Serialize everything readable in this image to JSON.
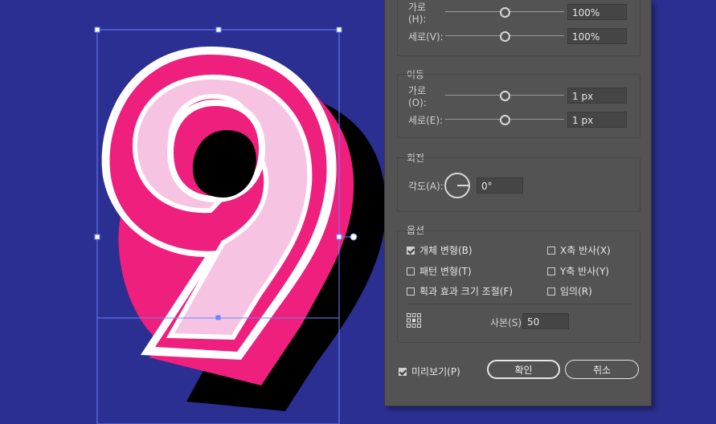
{
  "scale": {
    "horizontal_label": "가로(H):",
    "horizontal_value": "100%",
    "horizontal_level": 0.5,
    "vertical_label": "세로(V):",
    "vertical_value": "100%",
    "vertical_level": 0.5
  },
  "move": {
    "title": "이동",
    "horizontal_label": "가로(O):",
    "horizontal_value": "1 px",
    "horizontal_level": 0.5,
    "vertical_label": "세로(E):",
    "vertical_value": "1 px",
    "vertical_level": 0.5
  },
  "rotate": {
    "title": "회전",
    "angle_label": "각도(A):",
    "angle_value": "0°"
  },
  "options": {
    "title": "옵션",
    "transform_objects": "개체 변형(B)",
    "transform_objects_checked": true,
    "transform_patterns": "패턴 변형(T)",
    "transform_patterns_checked": false,
    "scale_strokes": "획과 효과 크기 조절(F)",
    "scale_strokes_checked": false,
    "reflect_x": "X축 반사(X)",
    "reflect_x_checked": false,
    "reflect_y": "Y축 반사(Y)",
    "reflect_y_checked": false,
    "random": "임의(R)",
    "random_checked": false,
    "copies_label": "사본(S)",
    "copies_value": "50"
  },
  "footer": {
    "preview_label": "미리보기(P)",
    "preview_checked": true,
    "ok_label": "확인",
    "cancel_label": "취소"
  },
  "colors": {
    "canvas": "#2b2f91",
    "pink": "#ee1f7d",
    "light_pink": "#f7c3e2",
    "shadow": "#000000",
    "selection": "#6b83ff"
  }
}
